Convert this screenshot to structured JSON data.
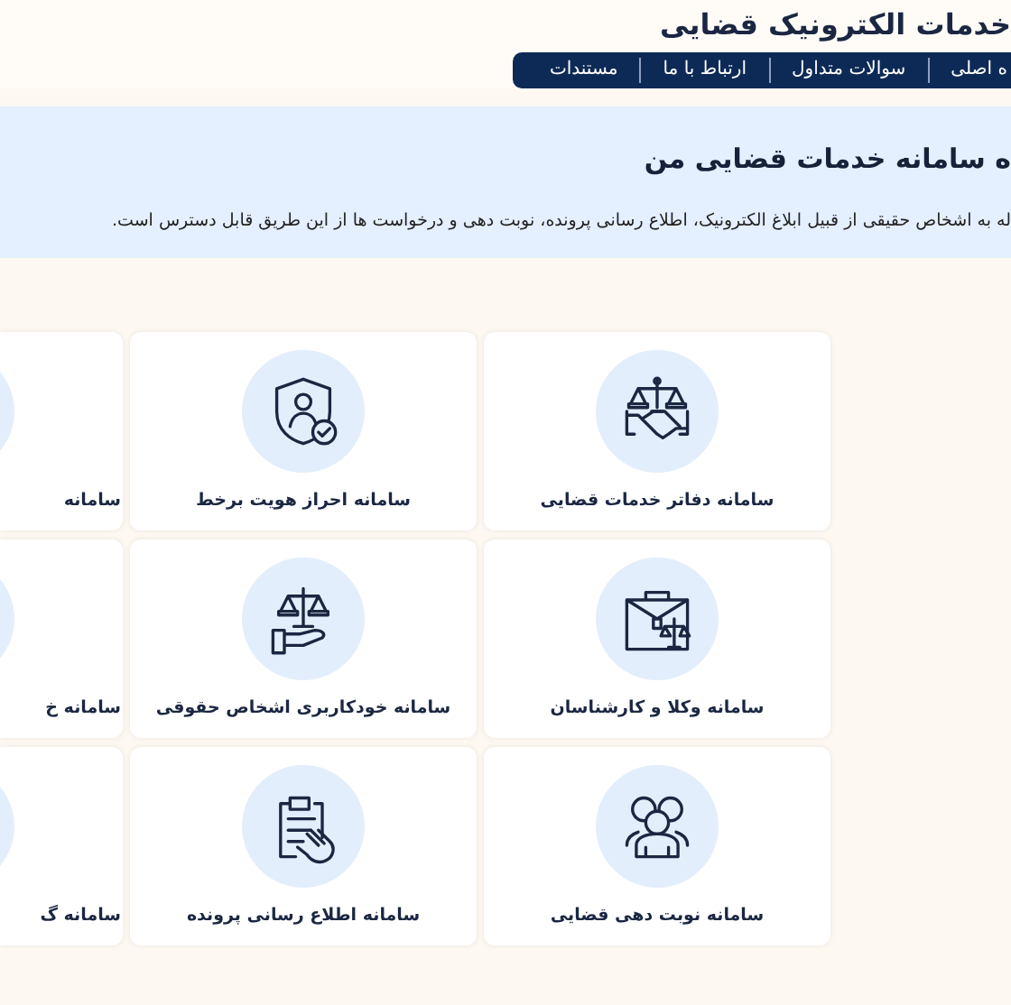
{
  "header": {
    "title": "خدمات الکترونیک قضایی",
    "nav": [
      "ه اصلی",
      "سوالات متداول",
      "ارتباط با ما",
      "مستندات"
    ]
  },
  "banner": {
    "title": "ه سامانه خدمات قضایی من",
    "description": "له به اشخاص حقیقی از قبیل ابلاغ الکترونیک، اطلاع رسانی پرونده، نوبت دهی و درخواست ها از این طریق قابل دسترس است."
  },
  "services": [
    {
      "label": "سامانه دفاتر خدمات قضایی"
    },
    {
      "label": "سامانه احراز هویت برخط"
    },
    {
      "label": "سامانه"
    },
    {
      "label": "سامانه وکلا و کارشناسان"
    },
    {
      "label": "سامانه خودکاربری اشخاص حقوقی"
    },
    {
      "label": "سامانه خ"
    },
    {
      "label": "سامانه نوبت دهی قضایی"
    },
    {
      "label": "سامانه اطلاع رسانی پرونده"
    },
    {
      "label": "سامانه گ"
    }
  ]
}
